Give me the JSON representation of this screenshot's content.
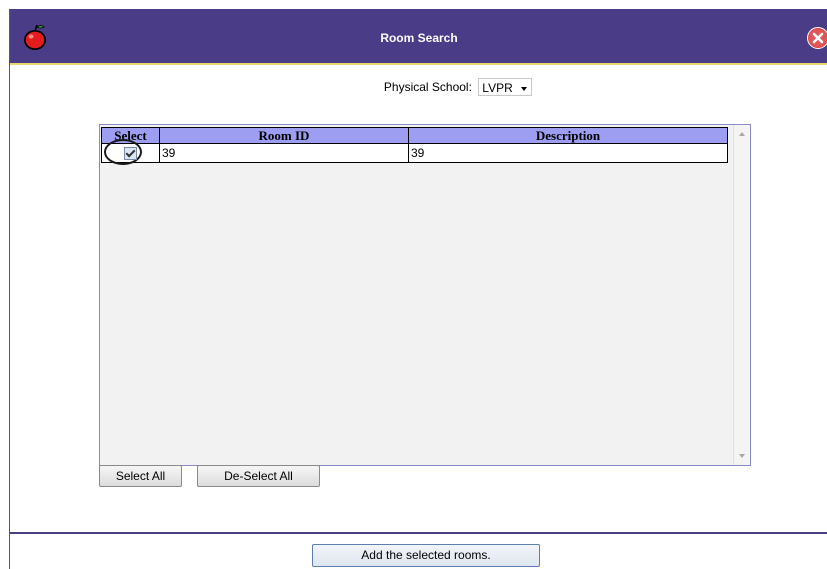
{
  "window": {
    "title": "Room Search",
    "colors": {
      "titlebar": "#4b3c88",
      "titlebar_border": "#e7d86a",
      "header_row": "#9d9df2"
    }
  },
  "icons": {
    "app": "apple-icon",
    "close": "close-icon"
  },
  "filter": {
    "label": "Physical School:",
    "selected_school": "LVPR"
  },
  "table": {
    "columns": [
      "Select",
      "Room ID",
      "Description"
    ],
    "rows": [
      {
        "selected": true,
        "room_id": "39",
        "description": "39"
      }
    ]
  },
  "buttons": {
    "select_all": "Select All",
    "deselect_all": "De-Select All",
    "add_selected": "Add the selected rooms."
  }
}
